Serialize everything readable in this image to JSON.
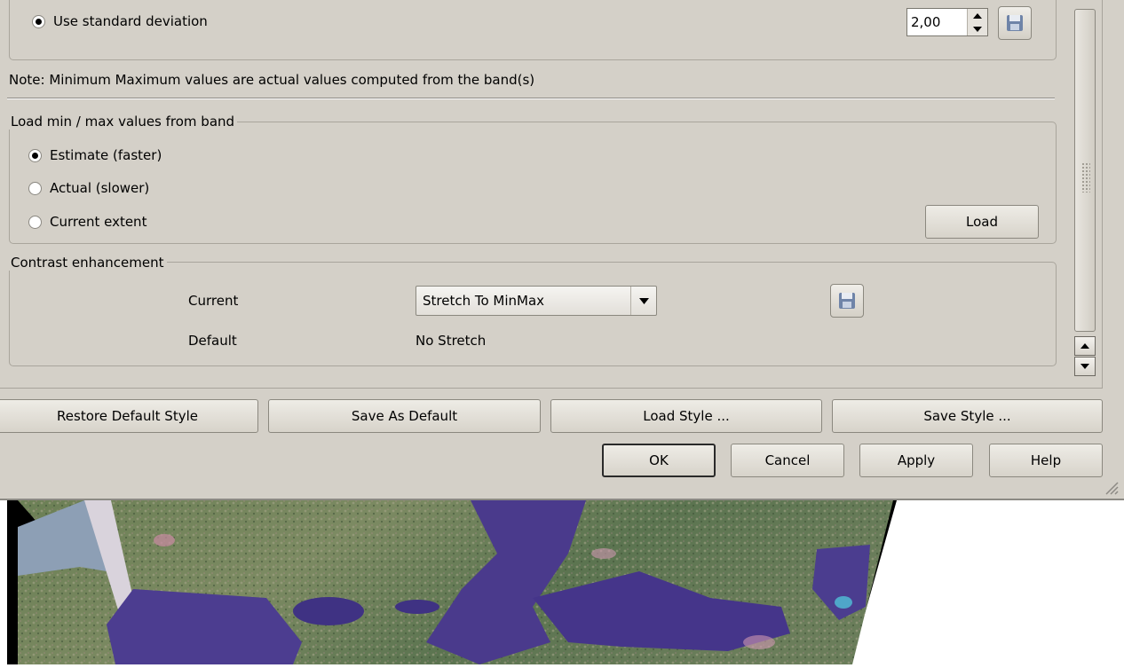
{
  "std_dev": {
    "label": "Use standard deviation",
    "value": "2,00",
    "selected": true
  },
  "note": "Note: Minimum Maximum values are actual values computed from the band(s)",
  "load_group": {
    "title": "Load min / max values from band",
    "options": [
      {
        "label": "Estimate (faster)",
        "selected": true
      },
      {
        "label": "Actual (slower)",
        "selected": false
      },
      {
        "label": "Current extent",
        "selected": false
      }
    ],
    "load_button": "Load"
  },
  "contrast_group": {
    "title": "Contrast enhancement",
    "current_label": "Current",
    "current_value": "Stretch To MinMax",
    "default_label": "Default",
    "default_value": "No Stretch"
  },
  "style_buttons": {
    "restore": "Restore Default Style",
    "save_default": "Save As Default",
    "load_style": "Load Style ...",
    "save_style": "Save Style ..."
  },
  "dialog_buttons": {
    "ok": "OK",
    "cancel": "Cancel",
    "apply": "Apply",
    "help": "Help"
  },
  "icons": [
    "floppy-disk-icon",
    "spin-up-icon",
    "spin-down-icon",
    "chevron-down-icon",
    "scroll-up-icon",
    "scroll-down-icon",
    "resize-grip-icon"
  ],
  "colors": {
    "dialog_bg": "#d4d0c8",
    "map_water": "#4b3c8e",
    "map_land": "#5f7a4e",
    "map_nodata": "#000000"
  }
}
